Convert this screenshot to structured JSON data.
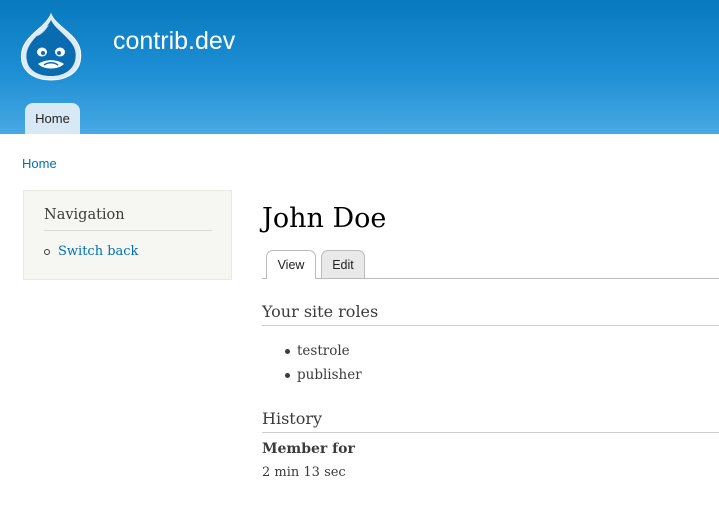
{
  "header": {
    "site_name": "contrib.dev",
    "primary_tab": "Home",
    "logo_icon": "drupal-drop-icon",
    "colors": {
      "top": "#0779bf",
      "bottom": "#48a9e4"
    }
  },
  "breadcrumb": {
    "home": "Home"
  },
  "sidebar": {
    "title": "Navigation",
    "items": [
      {
        "label": "Switch back"
      }
    ]
  },
  "main": {
    "title": "John Doe",
    "tabs": [
      {
        "label": "View",
        "active": true
      },
      {
        "label": "Edit",
        "active": false
      }
    ],
    "roles_title": "Your site roles",
    "roles": [
      "testrole",
      "publisher"
    ],
    "history_title": "History",
    "member_for_label": "Member for",
    "member_for_value": "2 min 13 sec"
  },
  "link_color": "#0071b3"
}
